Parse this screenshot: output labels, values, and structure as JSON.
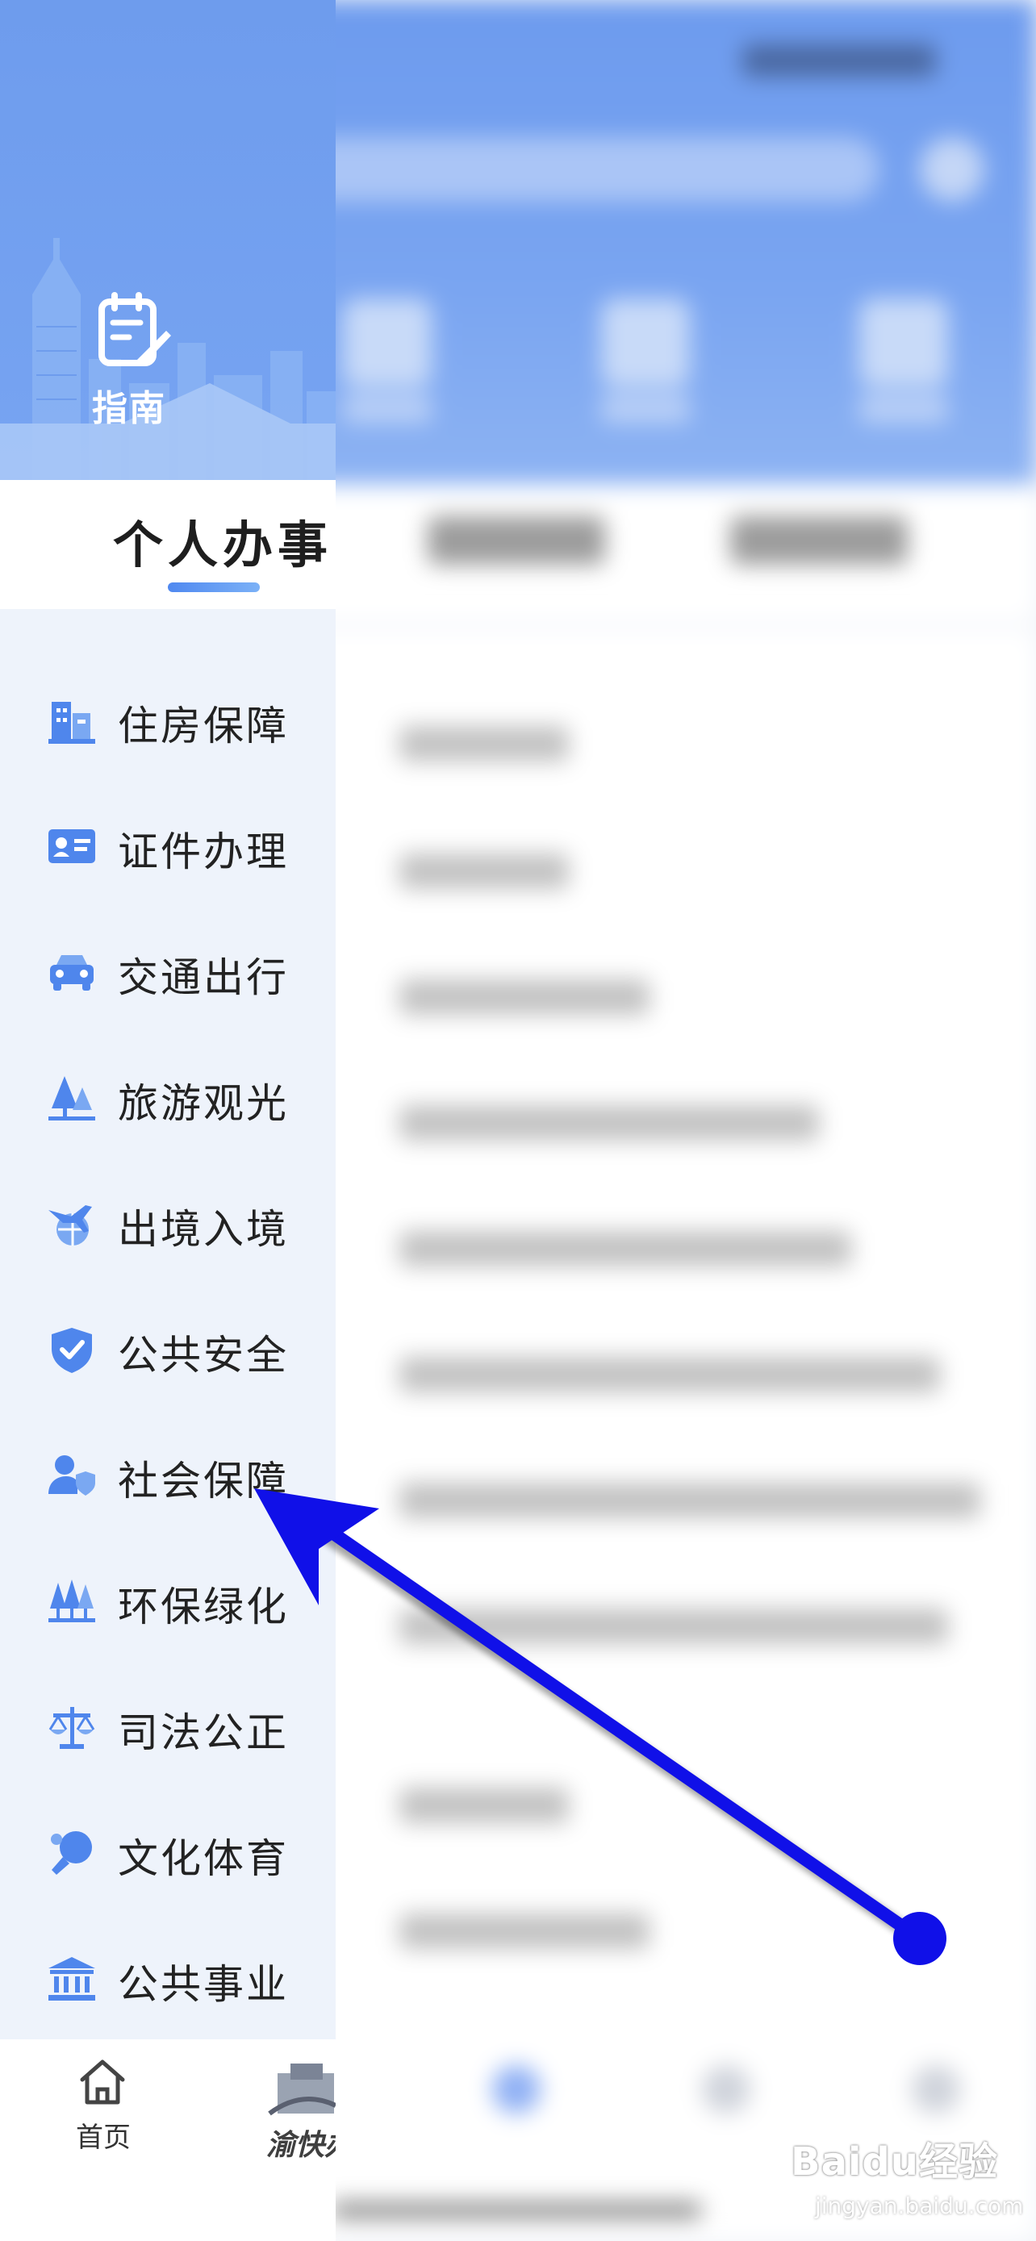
{
  "guide_panel": {
    "title": "指南",
    "tab": "个人办事",
    "categories": [
      {
        "label": "住房保障",
        "icon": "building-icon"
      },
      {
        "label": "证件办理",
        "icon": "id-card-icon"
      },
      {
        "label": "交通出行",
        "icon": "car-icon"
      },
      {
        "label": "旅游观光",
        "icon": "tree-icon"
      },
      {
        "label": "出境入境",
        "icon": "plane-globe-icon"
      },
      {
        "label": "公共安全",
        "icon": "shield-icon"
      },
      {
        "label": "社会保障",
        "icon": "person-shield-icon"
      },
      {
        "label": "环保绿化",
        "icon": "forest-icon"
      },
      {
        "label": "司法公正",
        "icon": "scale-icon"
      },
      {
        "label": "文化体育",
        "icon": "ping-pong-icon"
      },
      {
        "label": "公共事业",
        "icon": "bank-icon"
      }
    ]
  },
  "bottom_nav": {
    "home_label": "首页",
    "logo_text": "渝快办"
  },
  "watermark": {
    "brand": "Baidu经验",
    "url": "jingyan.baidu.com"
  },
  "colors": {
    "accent": "#5b8ff0",
    "header": "#6e9ced",
    "arrow": "#1010e8"
  }
}
